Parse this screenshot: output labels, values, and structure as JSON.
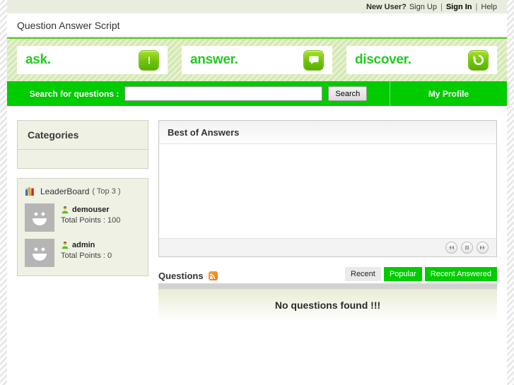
{
  "topbar": {
    "new_user_label": "New User?",
    "sign_up": "Sign Up",
    "sign_in": "Sign In",
    "help": "Help",
    "separator": "|"
  },
  "header": {
    "site_title": "Question Answer Script"
  },
  "banner": {
    "boxes": [
      {
        "word": "ask.",
        "icon": "exclamation-icon"
      },
      {
        "word": "answer.",
        "icon": "speech-bubble-icon"
      },
      {
        "word": "discover.",
        "icon": "refresh-icon"
      }
    ]
  },
  "search": {
    "label": "Search for questions :",
    "value": "",
    "placeholder": "",
    "button_label": "Search",
    "profile_label": "My Profile"
  },
  "sidebar": {
    "categories_title": "Categories",
    "leaderboard": {
      "title": "LeaderBoard",
      "subtitle": "( Top 3 )",
      "icon": "leaderboard-icon",
      "entries": [
        {
          "name": "demouser",
          "points_label": "Total Points : 100"
        },
        {
          "name": "admin",
          "points_label": "Total Points : 0"
        }
      ]
    }
  },
  "main": {
    "best_of_answers": {
      "title": "Best of Answers",
      "controls": [
        {
          "name": "previous-button",
          "glyph": "prev"
        },
        {
          "name": "pause-button",
          "glyph": "pause"
        },
        {
          "name": "next-button",
          "glyph": "next"
        }
      ]
    },
    "questions": {
      "title": "Questions",
      "feed_icon": "rss-icon",
      "tabs": [
        {
          "label": "Recent",
          "active": true
        },
        {
          "label": "Popular",
          "active": false
        },
        {
          "label": "Recent Answered",
          "active": false
        }
      ],
      "empty_message": "No questions found !!!"
    }
  },
  "colors": {
    "brand_green": "#00cc00",
    "banner_green": "#d8eabb",
    "sidebar_bg": "#eef1e4",
    "rss_orange": "#ee7b10"
  }
}
